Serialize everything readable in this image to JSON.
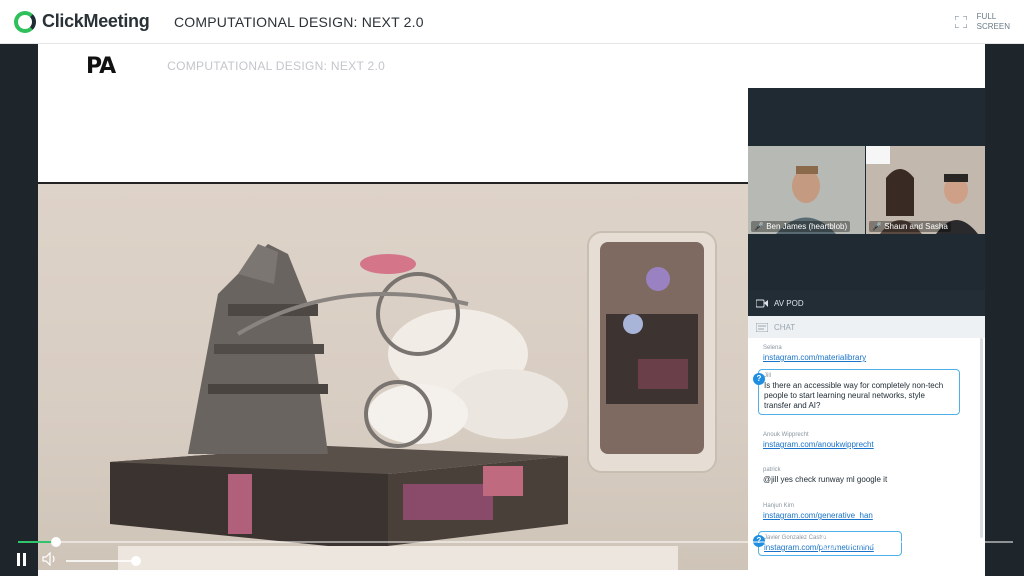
{
  "app": {
    "brand": "ClickMeeting",
    "title": "COMPUTATIONAL DESIGN: NEXT 2.0",
    "fullscreen_label_1": "FULL",
    "fullscreen_label_2": "SCREEN"
  },
  "slide": {
    "logo": "PA",
    "title": "COMPUTATIONAL DESIGN: NEXT 2.0"
  },
  "videos": [
    {
      "name": "Ben James (heartblob)"
    },
    {
      "name": "Shaun and Sasha"
    }
  ],
  "panels": {
    "av_pod": "AV POD",
    "chat": "CHAT"
  },
  "chat": [
    {
      "author": "Selena",
      "link": "instagram.com/materialibrary"
    },
    {
      "author": "Jill",
      "text": "Is there an accessible way for completely non-tech people to start learning neural networks, style transfer and AI?",
      "question": true
    },
    {
      "author": "Anouk Wipprecht",
      "link": "instagram.com/anoukwipprecht"
    },
    {
      "author": "patrick",
      "text": "@jill yes check runway ml google it"
    },
    {
      "author": "Hanjun Kim",
      "link": "instagram.com/generative_han"
    },
    {
      "author": "Javier Gonzalez Castro",
      "link": "instagram.com/parametricmind",
      "question": true
    }
  ],
  "player": {
    "progress": 0.038,
    "volume": 1.0
  },
  "watermark": "ClickMeeting",
  "colors": {
    "brand_green": "#2fbf5b",
    "link_blue": "#1a73c8",
    "question_blue": "#1f8de0",
    "dark_panel": "#1f2a33"
  }
}
